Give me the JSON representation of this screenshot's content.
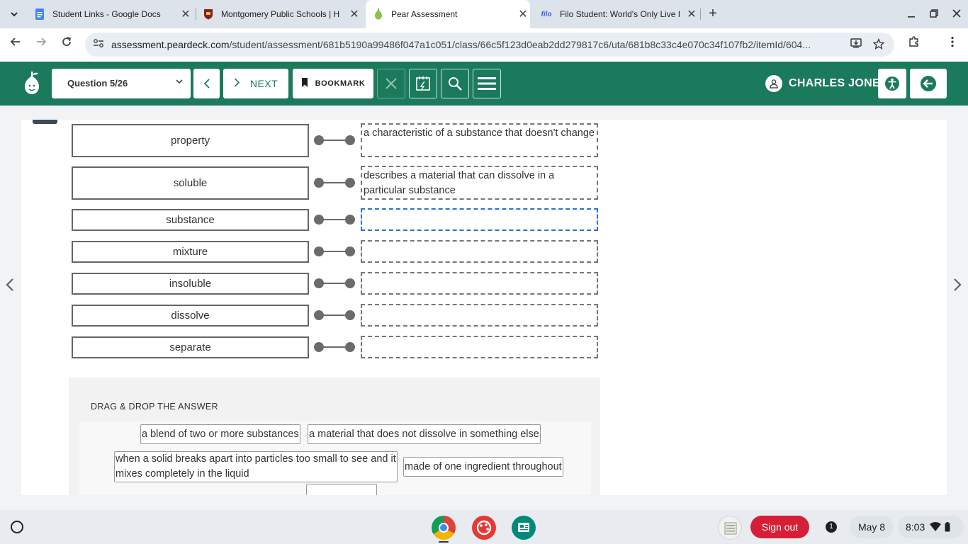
{
  "browser": {
    "tabs": [
      {
        "title": "Student Links - Google Docs",
        "favicon": "google-docs-icon",
        "active": false
      },
      {
        "title": "Montgomery Public Schools | H",
        "favicon": "school-crest-icon",
        "active": false
      },
      {
        "title": "Pear Assessment",
        "favicon": "pear-icon",
        "active": true
      },
      {
        "title": "Filo Student: World's Only Live I",
        "favicon": "filo-icon",
        "active": false
      }
    ],
    "filo_fav_text": "filo",
    "url_host": "assessment.peardeck.com",
    "url_path": "/student/assessment/681b5190a99486f047a1c051/class/66c5f123d0eab2dd279817c6/uta/681b8c33c4e070c34f107fb2/itemId/604..."
  },
  "header": {
    "question_selector": "Question 5/26",
    "next_label": "NEXT",
    "bookmark_label": "BOOKMARK",
    "user_name": "CHARLES JONES",
    "brand_color": "#1b7a5b"
  },
  "matching": {
    "rows": [
      {
        "term": "property",
        "answer": "a characteristic of a substance that doesn't change"
      },
      {
        "term": "soluble",
        "answer": "describes a material that can dissolve in a particular substance"
      },
      {
        "term": "substance",
        "answer": ""
      },
      {
        "term": "mixture",
        "answer": ""
      },
      {
        "term": "insoluble",
        "answer": ""
      },
      {
        "term": "dissolve",
        "answer": ""
      },
      {
        "term": "separate",
        "answer": ""
      }
    ]
  },
  "answer_bank": {
    "title": "DRAG & DROP THE ANSWER",
    "chips": [
      "a blend of two or more substances",
      "a material that does not dissolve in something else",
      "when a solid breaks apart into particles too small to see and it mixes completely in the liquid",
      "made of one ingredient throughout"
    ]
  },
  "shelf": {
    "signout_label": "Sign out",
    "notification_count": "1",
    "date": "May 8",
    "time": "8:03"
  }
}
